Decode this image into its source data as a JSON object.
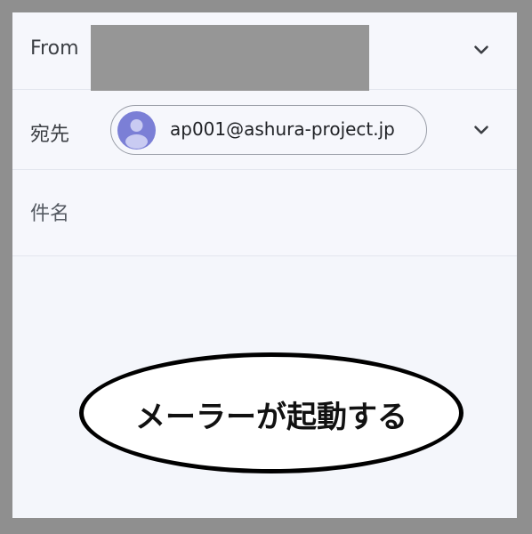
{
  "compose": {
    "from_label": "From",
    "to_label": "宛先",
    "subject_label": "件名",
    "recipient_chip": {
      "email": "ap001@ashura-project.jp"
    }
  },
  "annotation": {
    "text": "メーラーが起動する"
  },
  "icons": {
    "dropdown": "chevron-down-icon",
    "avatar": "person-icon",
    "redaction": "redacted-block"
  },
  "colors": {
    "avatar_bg": "#7b7fd6",
    "background": "#f4f6fb",
    "frame": "#8f8f8f",
    "redaction": "#969696"
  }
}
